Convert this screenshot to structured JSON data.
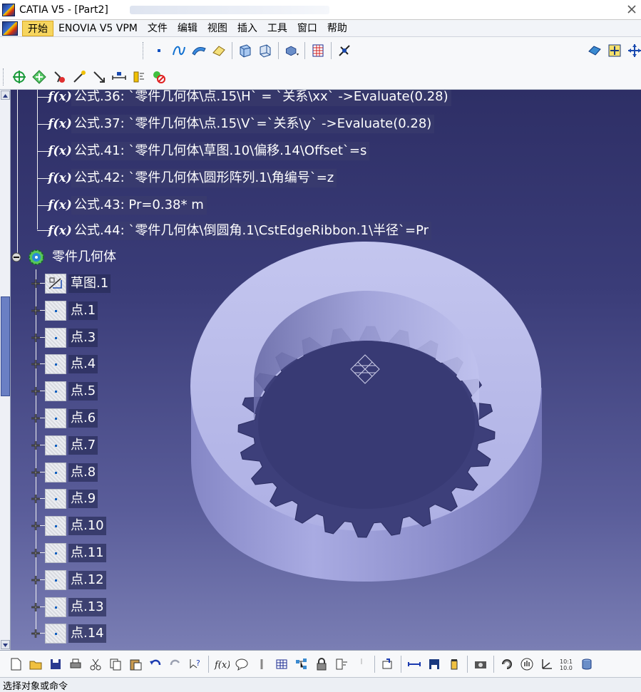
{
  "window": {
    "title": "CATIA V5 - [Part2]"
  },
  "menu": {
    "items": [
      "开始",
      "ENOVIA V5 VPM",
      "文件",
      "编辑",
      "视图",
      "插入",
      "工具",
      "窗口",
      "帮助"
    ]
  },
  "toolbar_top": {
    "row1_icons": [
      "point-icon",
      "spline-icon",
      "surface-icon",
      "eraser-icon",
      "view-front-icon",
      "view-back-icon",
      "render-style-icon",
      "table-icon",
      "compass-icon"
    ],
    "row1_right_icons": [
      "catalog-icon",
      "fit-all-icon",
      "pan-icon"
    ],
    "row2_icons": [
      "move-icon",
      "snap-icon",
      "hide-show-icon",
      "magnet-icon",
      "line-icon",
      "dimension-icon",
      "measure-icon",
      "clash-icon"
    ]
  },
  "tree": {
    "formulas": [
      {
        "label": "公式.36: `零件几何体\\点.15\\H` = `关系\\xx` ->Evaluate(0.28)"
      },
      {
        "label": "公式.37: `零件几何体\\点.15\\V`=`关系\\y` ->Evaluate(0.28)"
      },
      {
        "label": "公式.41: `零件几何体\\草图.10\\偏移.14\\Offset`=s"
      },
      {
        "label": "公式.42: `零件几何体\\圆形阵列.1\\角编号`=z"
      },
      {
        "label": "公式.43: Pr=0.38* m"
      },
      {
        "label": "公式.44: `零件几何体\\倒圆角.1\\CstEdgeRibbon.1\\半径`=Pr"
      }
    ],
    "body_label": "零件几何体",
    "children": [
      {
        "label": "草图.1",
        "kind": "sketch"
      },
      {
        "label": "点.1",
        "kind": "point"
      },
      {
        "label": "点.3",
        "kind": "point"
      },
      {
        "label": "点.4",
        "kind": "point"
      },
      {
        "label": "点.5",
        "kind": "point"
      },
      {
        "label": "点.6",
        "kind": "point"
      },
      {
        "label": "点.7",
        "kind": "point"
      },
      {
        "label": "点.8",
        "kind": "point"
      },
      {
        "label": "点.9",
        "kind": "point"
      },
      {
        "label": "点.10",
        "kind": "point"
      },
      {
        "label": "点.11",
        "kind": "point"
      },
      {
        "label": "点.12",
        "kind": "point"
      },
      {
        "label": "点.13",
        "kind": "point"
      },
      {
        "label": "点.14",
        "kind": "point"
      }
    ]
  },
  "bottom_toolbar": {
    "icons": [
      "new-icon",
      "open-icon",
      "save-icon",
      "print-icon",
      "cut-icon",
      "copy-icon",
      "paste-icon",
      "undo-icon",
      "redo-icon",
      "whats-this-icon",
      "formula-icon",
      "comment-icon",
      "knowledge-icon",
      "table-icon",
      "tree-icon",
      "lock-icon",
      "script-icon",
      "cursor-icon",
      "update-icon",
      "measure-icon",
      "save-doc-icon",
      "container-icon",
      "camera-icon",
      "rotate-icon",
      "hand-icon",
      "axis-icon",
      "zoom-icon",
      "cylinder-icon"
    ]
  },
  "status": {
    "text": "选择对象或命令"
  },
  "colors": {
    "viewport_top": "#2e2f66",
    "viewport_bottom": "#7a7eb4",
    "part_face": "#b9bbe8",
    "menu_active": "#f6d55e"
  }
}
